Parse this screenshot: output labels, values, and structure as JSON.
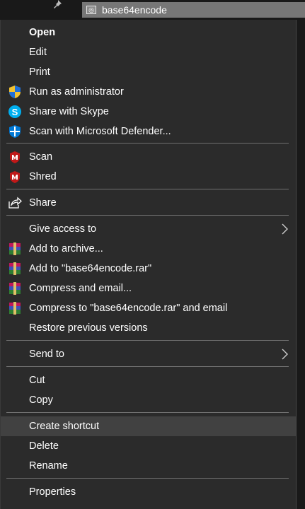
{
  "window": {
    "file_tab": "base64encode",
    "pin_icon": "pin-icon",
    "file_icon": "file-icon"
  },
  "menu": {
    "open": "Open",
    "edit": "Edit",
    "print": "Print",
    "run_as_admin": "Run as administrator",
    "share_skype": "Share with Skype",
    "scan_defender": "Scan with Microsoft Defender...",
    "scan": "Scan",
    "shred": "Shred",
    "share": "Share",
    "give_access": "Give access to",
    "add_archive": "Add to archive...",
    "add_rar": "Add to \"base64encode.rar\"",
    "compress_email": "Compress and email...",
    "compress_rar_email": "Compress to \"base64encode.rar\" and email",
    "restore_versions": "Restore previous versions",
    "send_to": "Send to",
    "cut": "Cut",
    "copy": "Copy",
    "create_shortcut": "Create shortcut",
    "delete": "Delete",
    "rename": "Rename",
    "properties": "Properties"
  },
  "icons": {
    "uac_shield": "uac-shield-icon",
    "skype": "skype-icon",
    "defender": "defender-shield-icon",
    "mcafee": "mcafee-icon",
    "share": "share-icon",
    "winrar": "winrar-icon",
    "chevron": "chevron-right-icon"
  },
  "colors": {
    "menu_bg": "#2b2b2b",
    "highlight_bg": "#414141",
    "separator": "#707070",
    "text": "#ffffff",
    "skype_blue": "#00aff0",
    "defender_blue": "#0078d4",
    "mcafee_red": "#c01818"
  },
  "state": {
    "highlighted_item": "Create shortcut"
  }
}
